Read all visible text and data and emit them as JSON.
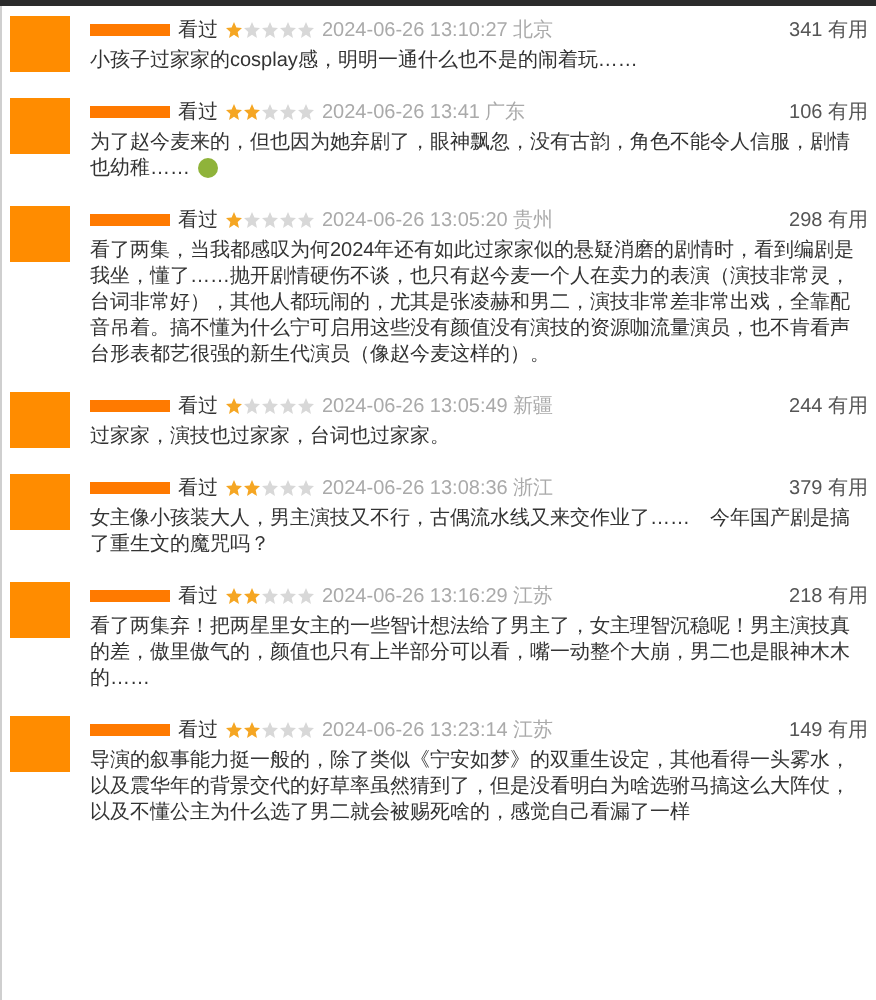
{
  "comments": [
    {
      "status": "看过",
      "stars": 1,
      "time": "2024-06-26 13:10:27 北京",
      "votes": "341 有用",
      "text": "小孩子过家家的cosplay感，明明一通什么也不是的闹着玩……"
    },
    {
      "status": "看过",
      "stars": 2,
      "time": "2024-06-26 13:41 广东",
      "votes": "106 有用",
      "text": "为了赵今麦来的，但也因为她弃剧了，眼神飘忽，没有古韵，角色不能令人信服，剧情也幼稚……",
      "emoji": true
    },
    {
      "status": "看过",
      "stars": 1,
      "time": "2024-06-26 13:05:20 贵州",
      "votes": "298 有用",
      "text": "看了两集，当我都感叹为何2024年还有如此过家家似的悬疑消磨的剧情时，看到编剧是我坐，懂了……抛开剧情硬伤不谈，也只有赵今麦一个人在卖力的表演（演技非常灵，台词非常好），其他人都玩闹的，尤其是张凌赫和男二，演技非常差非常出戏，全靠配音吊着。搞不懂为什么宁可启用这些没有颜值没有演技的资源咖流量演员，也不肯看声台形表都艺很强的新生代演员（像赵今麦这样的）。"
    },
    {
      "status": "看过",
      "stars": 1,
      "time": "2024-06-26 13:05:49 新疆",
      "votes": "244 有用",
      "text": "过家家，演技也过家家，台词也过家家。"
    },
    {
      "status": "看过",
      "stars": 2,
      "time": "2024-06-26 13:08:36 浙江",
      "votes": "379 有用",
      "text": "女主像小孩装大人，男主演技又不行，古偶流水线又来交作业了……　今年国产剧是搞了重生文的魔咒吗？"
    },
    {
      "status": "看过",
      "stars": 2,
      "time": "2024-06-26 13:16:29 江苏",
      "votes": "218 有用",
      "text": "看了两集弃！把两星里女主的一些智计想法给了男主了，女主理智沉稳呢！男主演技真的差，傲里傲气的，颜值也只有上半部分可以看，嘴一动整个大崩，男二也是眼神木木的……"
    },
    {
      "status": "看过",
      "stars": 2,
      "time": "2024-06-26 13:23:14 江苏",
      "votes": "149 有用",
      "text": "导演的叙事能力挺一般的，除了类似《宁安如梦》的双重生设定，其他看得一头雾水，以及震华年的背景交代的好草率虽然猜到了，但是没看明白为啥选驸马搞这么大阵仗，以及不懂公主为什么选了男二就会被赐死啥的，感觉自己看漏了一样"
    }
  ]
}
